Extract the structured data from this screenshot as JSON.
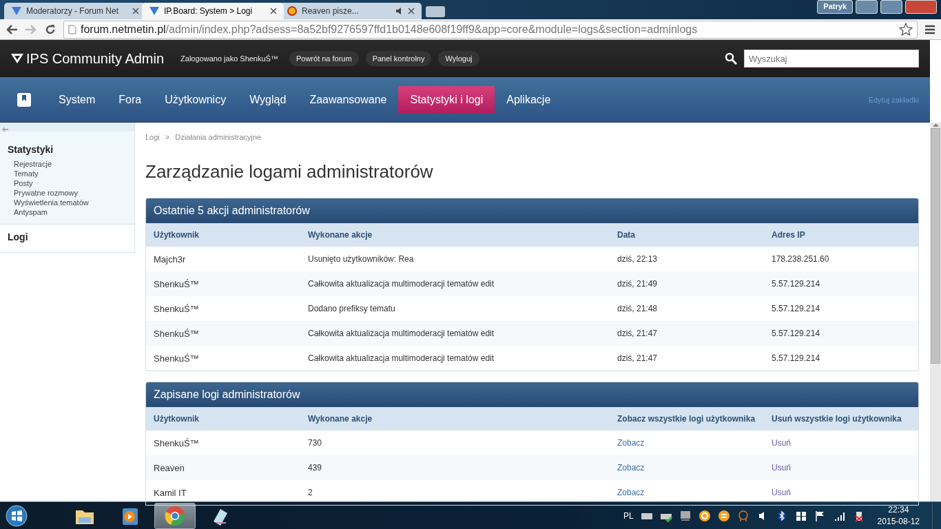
{
  "browser": {
    "tabs": [
      {
        "title": "Moderatorzy - Forum Net",
        "selected": false,
        "audio": false
      },
      {
        "title": "IP.Board: System > Logi",
        "selected": true,
        "audio": false
      },
      {
        "title": "Reaven pisze...",
        "selected": false,
        "audio": true
      }
    ],
    "user": "Patryk",
    "url_host": "forum.netmetin.pl",
    "url_path": "/admin/index.php?adsess=8a52bf9276597ffd1b0148e608f19ff9&app=core&module=logs&section=adminlogs"
  },
  "header": {
    "logo": "IPS Community Admin",
    "logged_in": "Zalogowano jako ShenkuŚ™",
    "links": [
      "Powrót na forum",
      "Panel kontrolny",
      "Wyloguj"
    ],
    "search_placeholder": "Wyszukaj"
  },
  "nav": {
    "items": [
      {
        "label": "System",
        "selected": false
      },
      {
        "label": "Fora",
        "selected": false
      },
      {
        "label": "Użytkownicy",
        "selected": false
      },
      {
        "label": "Wygląd",
        "selected": false
      },
      {
        "label": "Zaawansowane",
        "selected": false
      },
      {
        "label": "Statystyki i logi",
        "selected": true
      },
      {
        "label": "Aplikacje",
        "selected": false
      }
    ],
    "edit_link": "Edytuj zakładki"
  },
  "sidebar": {
    "sections": [
      {
        "title": "Statystyki",
        "items": [
          "Rejestracje",
          "Tematy",
          "Posty",
          "Prywatne rozmowy",
          "Wyświetlenia tematów",
          "Antyspam"
        ]
      },
      {
        "title": "Logi"
      }
    ]
  },
  "breadcrumb": {
    "items": [
      "Logi",
      "Działania administracyjne"
    ],
    "separator": ">"
  },
  "page_title": "Zarządzanie logami administratorów",
  "panels": [
    {
      "title": "Ostatnie 5 akcji administratorów",
      "columns": [
        {
          "label": "Użytkownik",
          "kind": "text"
        },
        {
          "label": "Wykonane akcje",
          "kind": "text"
        },
        {
          "label": "Data",
          "kind": "text"
        },
        {
          "label": "Adres IP",
          "kind": "text"
        }
      ],
      "rows": [
        [
          "Majch3r",
          "Usunięto użytkowników: Rea",
          "dziś, 22:13",
          "178.238.251.60"
        ],
        [
          "ShenkuŚ™",
          "Całkowita aktualizacja multimoderacji tematów edit",
          "dziś, 21:49",
          "5.57.129.214"
        ],
        [
          "ShenkuŚ™",
          "Dodano prefiksy tematu",
          "dziś, 21:48",
          "5.57.129.214"
        ],
        [
          "ShenkuŚ™",
          "Całkowita aktualizacja multimoderacji tematów edit",
          "dziś, 21:47",
          "5.57.129.214"
        ],
        [
          "ShenkuŚ™",
          "Całkowita aktualizacja multimoderacji tematów edit",
          "dziś, 21:47",
          "5.57.129.214"
        ]
      ]
    },
    {
      "title": "Zapisane logi administratorów",
      "columns": [
        {
          "label": "Użytkownik",
          "kind": "text"
        },
        {
          "label": "Wykonane akcje",
          "kind": "text"
        },
        {
          "label": "Zobacz wszystkie logi użytkownika",
          "kind": "link"
        },
        {
          "label": "Usuń wszystkie logi użytkownika",
          "kind": "visited-link"
        }
      ],
      "rows": [
        [
          "ShenkuŚ™",
          "730",
          "Zobacz",
          "Usuń"
        ],
        [
          "Reaven",
          "439",
          "Zobacz",
          "Usuń"
        ],
        [
          "Kamil IT",
          "2",
          "Zobacz",
          "Usuń"
        ]
      ]
    }
  ],
  "taskbar": {
    "apps": [
      {
        "kind": "folder",
        "selected": false
      },
      {
        "kind": "media",
        "selected": false
      },
      {
        "kind": "browser",
        "selected": true
      },
      {
        "kind": "notepad",
        "selected": false
      }
    ],
    "language": "PL",
    "time": "22:34",
    "date": "2015-08-12"
  }
}
